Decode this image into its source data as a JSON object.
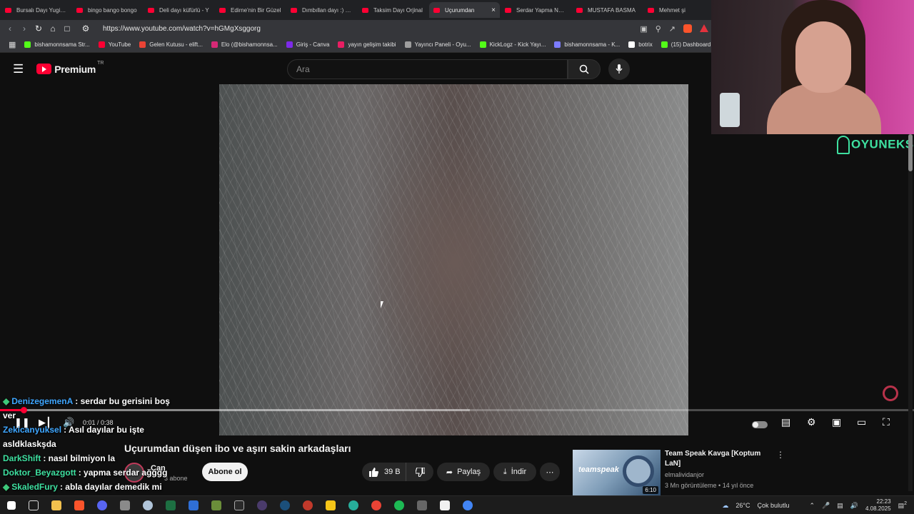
{
  "browser": {
    "tabs": [
      {
        "label": "Bursalı Dayı Yugi-Oh",
        "active": false
      },
      {
        "label": "bingo bango bongo",
        "active": false
      },
      {
        "label": "Deli dayı küfürlü - Y",
        "active": false
      },
      {
        "label": "Edirne'nin Bir Güzel",
        "active": false
      },
      {
        "label": "Dımbıllan dayı :) #sh",
        "active": false
      },
      {
        "label": "Taksim Dayı Orjinal",
        "active": false
      },
      {
        "label": "Uçurumdan",
        "active": true
      },
      {
        "label": "Serdar Yapma Nolur",
        "active": false
      },
      {
        "label": "MUSTAFA BASMA",
        "active": false
      },
      {
        "label": "Mehmet şi",
        "active": false
      }
    ],
    "url": "https://www.youtube.com/watch?v=hGMgXsggorg",
    "bookmarks": [
      {
        "label": "bishamonnsama Str...",
        "color": "#53fc18"
      },
      {
        "label": "YouTube",
        "color": "#ff0033"
      },
      {
        "label": "Gelen Kutusu - elift...",
        "color": "#ea4335"
      },
      {
        "label": "Elo (@bishamonnsa...",
        "color": "#d62976"
      },
      {
        "label": "Giriş - Canva",
        "color": "#7d2ae8"
      },
      {
        "label": "yayın gelişim takibi",
        "color": "#e91e63"
      },
      {
        "label": "Yayıncı Paneli - Oyu...",
        "color": "#9e9e9e"
      },
      {
        "label": "KickLogz - Kick Yayı...",
        "color": "#53fc18"
      },
      {
        "label": "bishamonnsama - K...",
        "color": "#7c7cff"
      },
      {
        "label": "botrix",
        "color": "#ffffff"
      },
      {
        "label": "(15) Dashboard",
        "color": "#53fc18"
      }
    ]
  },
  "youtube": {
    "brand": "Premium",
    "region": "TR",
    "search_placeholder": "Ara",
    "player": {
      "current_time": "0:01",
      "duration": "0:38",
      "progress_fraction": 0.026
    },
    "video_title": "Uçurumdan düşen ibo ve aşırı sakin arkadaşları",
    "channel_name": "Can",
    "subscribers": "3 abone",
    "subscribe_label": "Abone ol",
    "likes": "39 B",
    "share_label": "Paylaş",
    "download_label": "İndir",
    "related": {
      "title": "Team Speak Kavga [Koptum LaN]",
      "channel": "elmalividanjor",
      "meta": "3 Mn görüntüleme • 14 yıl önce",
      "duration": "6:10",
      "thumb_text": "teamspeak"
    }
  },
  "chat": [
    {
      "user": "DenizegemenA",
      "message": ": serdar bu gerisini boş",
      "color": "#3ea6ff",
      "badge": true
    },
    {
      "user": "",
      "message": "ver",
      "color": "#ffffff",
      "badge": false
    },
    {
      "user": "Zekicanyuksel",
      "message": ": Asıl dayılar bu işte",
      "color": "#3ea6ff",
      "badge": false
    },
    {
      "user": "",
      "message": "asldklaskşda",
      "color": "#ffffff",
      "badge": false
    },
    {
      "user": "DarkShift",
      "message": ": nasıl bilmiyon la",
      "color": "#3ee0a0",
      "badge": false
    },
    {
      "user": "Doktor_Beyazgott",
      "message": ": yapma serdar ağggg",
      "color": "#3ee0a0",
      "badge": false
    },
    {
      "user": "SkaledFury",
      "message": ": abla dayılar demedik mi",
      "color": "#3ee0a0",
      "badge": true
    }
  ],
  "overlay": {
    "brand_logo": "OYUNEKS"
  },
  "taskbar": {
    "temperature": "26°C",
    "weather": "Çok bulutlu",
    "time": "22:23",
    "date": "4.08.2025",
    "notification_count": "2"
  }
}
